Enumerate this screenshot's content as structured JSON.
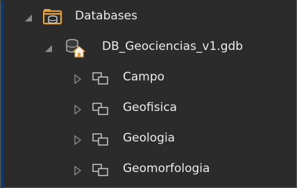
{
  "colors": {
    "background": "#2b2b2b",
    "text": "#ececec",
    "accent_bar": "#123a70",
    "expander": "#8a8a8a",
    "folder_gold": "#e8a23a",
    "database_gray": "#b0b0b0",
    "home_orange": "#e8a23a",
    "dataset_gray": "#bdbdbd"
  },
  "tree": {
    "root": {
      "label": "Databases",
      "icon": "folder-database-icon",
      "expanded": true
    },
    "geodatabase": {
      "label": "DB_Geociencias_v1.gdb",
      "icon": "home-geodatabase-icon",
      "expanded": true
    },
    "datasets": [
      {
        "label": "Campo",
        "icon": "feature-dataset-icon",
        "expanded": false
      },
      {
        "label": "Geofisica",
        "icon": "feature-dataset-icon",
        "expanded": false
      },
      {
        "label": "Geologia",
        "icon": "feature-dataset-icon",
        "expanded": false
      },
      {
        "label": "Geomorfologia",
        "icon": "feature-dataset-icon",
        "expanded": false
      }
    ]
  }
}
